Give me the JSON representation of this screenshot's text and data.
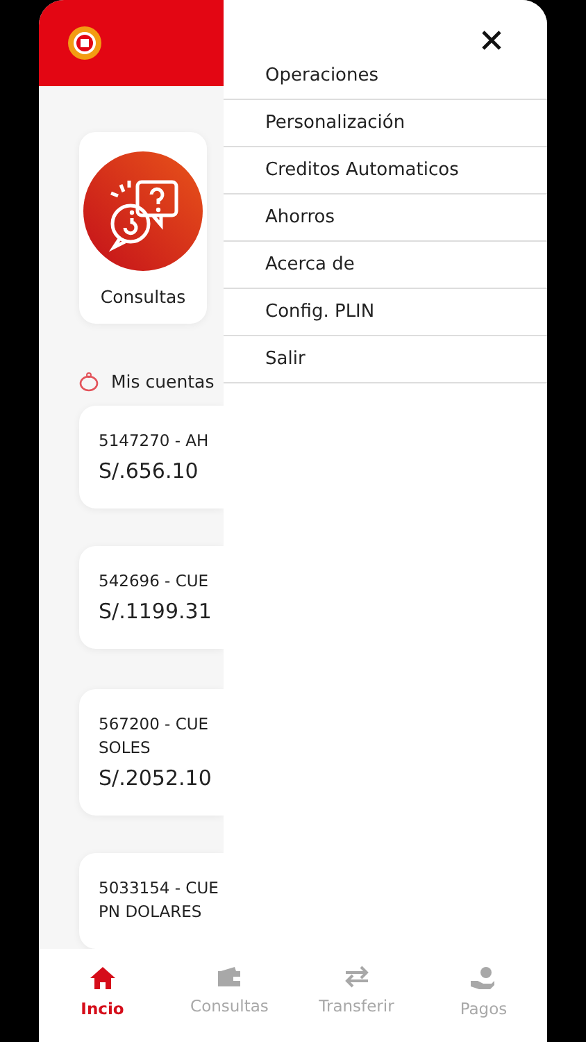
{
  "shortcut": {
    "label": "Consultas"
  },
  "accounts_title": "Mis cuentas",
  "accounts": [
    {
      "lines": [
        "5147270 - AH"
      ],
      "balance": "S/.656.10"
    },
    {
      "lines": [
        "542696 - CUE"
      ],
      "balance": "S/.1199.31"
    },
    {
      "lines": [
        "567200 - CUE",
        "SOLES"
      ],
      "balance": "S/.2052.10"
    },
    {
      "lines": [
        "5033154 - CUE",
        "PN DOLARES"
      ]
    }
  ],
  "menu": {
    "items": [
      {
        "label": "Operaciones"
      },
      {
        "label": "Personalización"
      },
      {
        "label": "Creditos Automaticos"
      },
      {
        "label": "Ahorros"
      },
      {
        "label": "Acerca de"
      },
      {
        "label": "Config. PLIN"
      },
      {
        "label": "Salir"
      }
    ]
  },
  "nav": [
    {
      "kind": "home",
      "label": "Incio",
      "selected": true
    },
    {
      "kind": "wallet",
      "label": "Consultas",
      "selected": false
    },
    {
      "kind": "transfer",
      "label": "Transferir",
      "selected": false
    },
    {
      "kind": "pay",
      "label": "Pagos",
      "selected": false
    }
  ]
}
